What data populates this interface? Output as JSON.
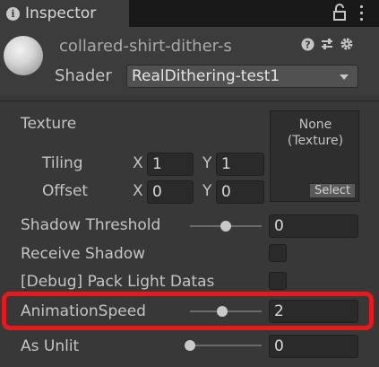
{
  "tabbar": {
    "tab_label": "Inspector",
    "tab_icon": "info-icon",
    "lock_icon": "lock-icon",
    "menu_icon": "kebab-menu-icon"
  },
  "header": {
    "material_name": "collared-shirt-dither-s",
    "shader_label": "Shader",
    "shader_value": "RealDithering-test1",
    "icons": [
      "help-icon",
      "preset-icon",
      "settings-icon"
    ]
  },
  "texture": {
    "label": "Texture",
    "slot_text": "None\n(Texture)",
    "select_label": "Select",
    "tiling": {
      "label": "Tiling",
      "x_axis": "X",
      "x": "1",
      "y_axis": "Y",
      "y": "1"
    },
    "offset": {
      "label": "Offset",
      "x_axis": "X",
      "x": "0",
      "y_axis": "Y",
      "y": "0"
    }
  },
  "properties": {
    "shadow_threshold": {
      "label": "Shadow Threshold",
      "value": "0",
      "slider_fraction": 0.5
    },
    "receive_shadow": {
      "label": "Receive Shadow"
    },
    "pack_light": {
      "label": "[Debug] Pack Light Datas"
    },
    "animation_speed": {
      "label": "AnimationSpeed",
      "value": "2",
      "slider_fraction": 0.45
    },
    "as_unlit": {
      "label": "As Unlit",
      "value": "0",
      "slider_fraction": 0.0
    }
  },
  "colors": {
    "highlight": "#e8191c",
    "panel": "#383838",
    "field": "#2a2a2a"
  }
}
